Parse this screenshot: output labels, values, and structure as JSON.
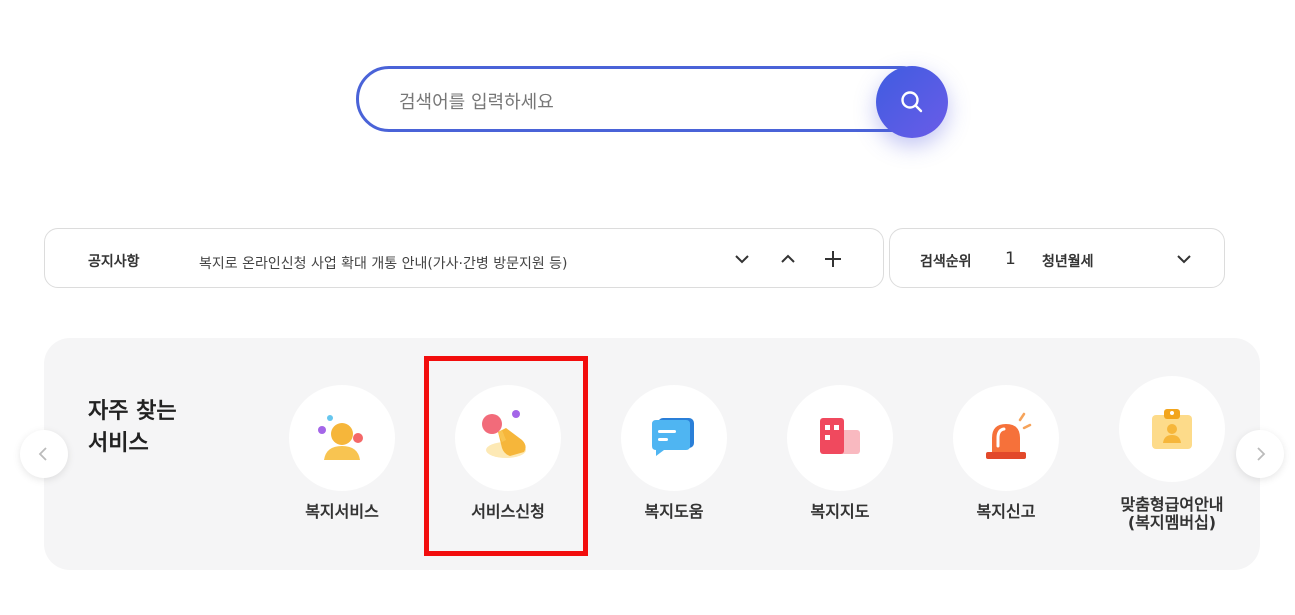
{
  "search": {
    "placeholder": "검색어를 입력하세요",
    "value": ""
  },
  "notice": {
    "label": "공지사항",
    "text": "복지로 온라인신청 사업 확대 개통 안내(가사·간병 방문지원 등)"
  },
  "rank": {
    "label": "검색순위",
    "number": "1",
    "term": "청년월세"
  },
  "services": {
    "title_line1": "자주 찾는",
    "title_line2": "서비스",
    "items": [
      {
        "label": "복지서비스",
        "icon": "person-icon"
      },
      {
        "label": "서비스신청",
        "icon": "hand-touch-icon"
      },
      {
        "label": "복지도움",
        "icon": "chat-bubble-icon"
      },
      {
        "label": "복지지도",
        "icon": "building-map-icon"
      },
      {
        "label": "복지신고",
        "icon": "siren-icon"
      },
      {
        "label_line1": "맞춤형급여안내",
        "label_line2": "(복지멤버십)",
        "icon": "id-badge-icon"
      }
    ]
  },
  "colors": {
    "accent": "#4a63d8",
    "highlight": "#f20d0d",
    "panel": "#f5f5f6"
  }
}
